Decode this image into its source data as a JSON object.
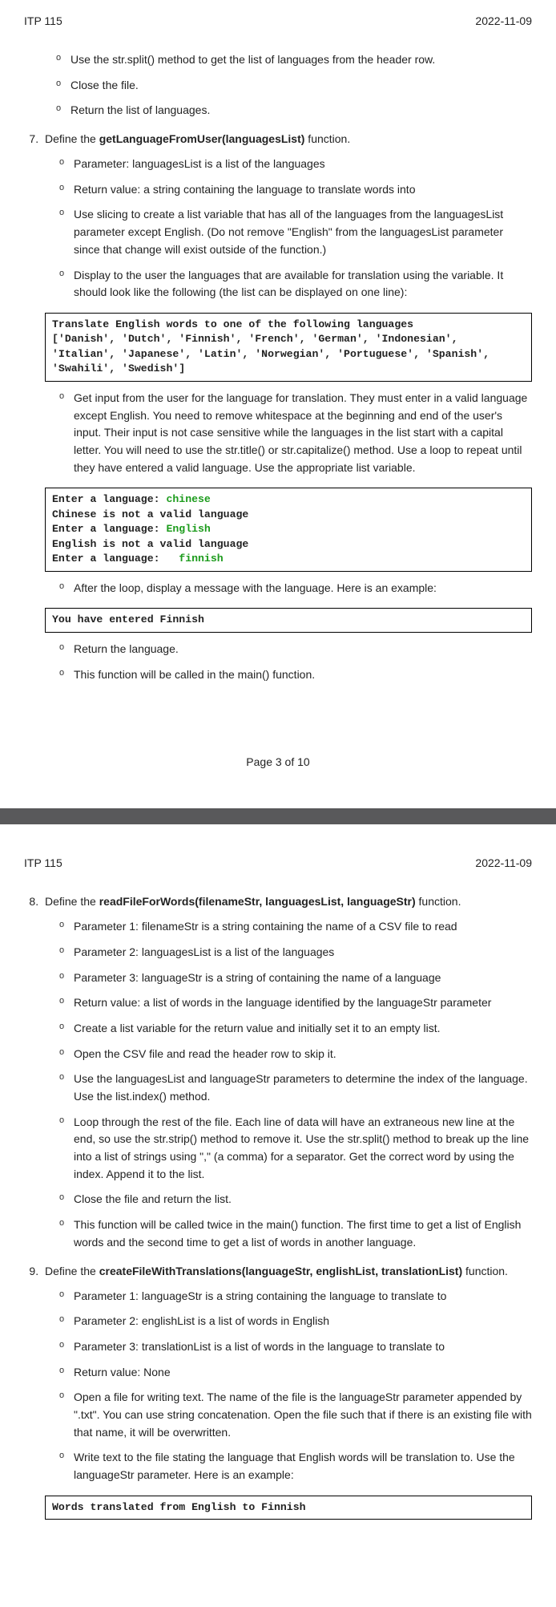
{
  "page1": {
    "header_left": "ITP 115",
    "header_right": "2022-11-09",
    "pre_items": [
      "Use the str.split() method to get the list of languages from the header row.",
      "Close the file.",
      "Return the list of languages."
    ],
    "item7_intro": "Define the ",
    "item7_bold": "getLanguageFromUser(languagesList)",
    "item7_after": " function.",
    "item7_sub": {
      "a": "Parameter: languagesList is a list of the languages",
      "b": "Return value: a string containing the language to translate words into",
      "c": "Use slicing to create a list variable that has all of the languages from the languagesList parameter except English. (Do not remove \"English\" from the languagesList parameter since that change will exist outside of the function.)",
      "d": "Display to the user the languages that are available for translation using the variable. It should look like the following (the list can be displayed on one line):",
      "d_code": "Translate English words to one of the following languages\n['Danish', 'Dutch', 'Finnish', 'French', 'German', 'Indonesian', 'Italian', 'Japanese', 'Latin', 'Norwegian', 'Portuguese', 'Spanish', 'Swahili', 'Swedish']",
      "e": "Get input from the user for the language for translation. They must enter in a valid language except English. You need to remove whitespace at the beginning and end of the user's input. Their input is not case sensitive while the languages in the list start with a capital letter. You will need to use the str.title() or str.capitalize() method. Use a loop to repeat until they have entered a valid language. Use the appropriate list variable.",
      "e_code_l1a": "Enter a language: ",
      "e_code_l1b": "chinese",
      "e_code_l2": "Chinese is not a valid language",
      "e_code_l3a": "Enter a language: ",
      "e_code_l3b": "English",
      "e_code_l4": "English is not a valid language",
      "e_code_l5a": "Enter a language:   ",
      "e_code_l5b": "finnish",
      "f": "After the loop, display a message with the language. Here is an example:",
      "f_code": "You have entered Finnish",
      "g": "Return the language.",
      "h": "This function will be called in the main() function."
    },
    "footer": "Page 3 of 10"
  },
  "page2": {
    "header_left": "ITP 115",
    "header_right": "2022-11-09",
    "item8_intro": "Define the ",
    "item8_bold": "readFileForWords(filenameStr, languagesList, languageStr)",
    "item8_after": " function.",
    "item8_sub": {
      "a": "Parameter 1: filenameStr is a string containing the name of a CSV file to read",
      "b": "Parameter 2: languagesList is a list of the languages",
      "c": "Parameter 3: languageStr is a string of containing the name of a language",
      "d": "Return value: a list of words in the language identified by the languageStr parameter",
      "e": "Create a list variable for the return value and initially set it to an empty list.",
      "f": "Open the CSV file and read the header row to skip it.",
      "g": "Use the languagesList and languageStr parameters to determine the index of the language. Use the list.index() method.",
      "h": "Loop through the rest of the file. Each line of data will have an extraneous new line at the end, so use the str.strip() method to remove it. Use the str.split() method to break up the line into a list of strings using \",\" (a comma) for a separator. Get the correct word by using the index. Append it to the list.",
      "i": "Close the file and return the list.",
      "j": "This function will be called twice in the main() function. The first time to get a list of English words and the second time to get a list of words in another language."
    },
    "item9_intro": "Define the ",
    "item9_bold": "createFileWithTranslations(languageStr, englishList, translationList)",
    "item9_after": " function.",
    "item9_sub": {
      "a": "Parameter 1: languageStr is a string containing the language to translate to",
      "b": "Parameter 2: englishList is a list of words in English",
      "c": "Parameter 3: translationList is a list of words in the language to translate to",
      "d": "Return value: None",
      "e": "Open a file for writing text. The name of the file is the languageStr parameter appended by \".txt\". You can use string concatenation. Open the file such that if there is an existing file with that name, it will be overwritten.",
      "f": "Write text to the file stating the language that English words will be translation to. Use the languageStr parameter. Here is an example:",
      "f_code": "Words translated from English to Finnish"
    }
  }
}
